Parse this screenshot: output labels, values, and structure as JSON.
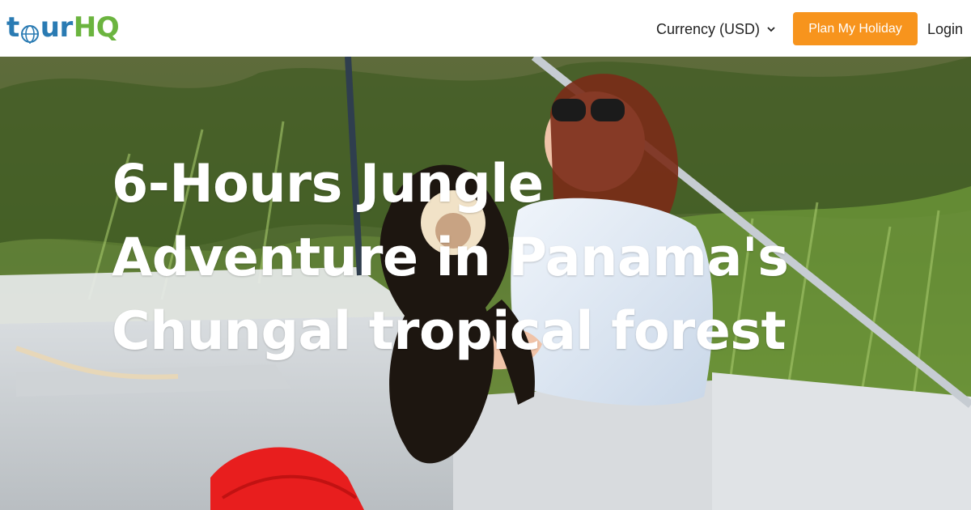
{
  "header": {
    "logo": {
      "part1": "t",
      "part2": "ur",
      "part3": "HQ"
    },
    "currency_label": "Currency (USD)",
    "plan_label": "Plan My Holiday",
    "login_label": "Login"
  },
  "hero": {
    "title": "6-Hours Jungle Adventure in Panama's Chungal tropical forest"
  },
  "colors": {
    "logo_blue": "#2a7bb3",
    "logo_green": "#6bb43f",
    "cta_orange": "#f7941d"
  },
  "icons": {
    "currency_dropdown": "chevron-down-icon",
    "logo_globe": "globe-icon"
  }
}
